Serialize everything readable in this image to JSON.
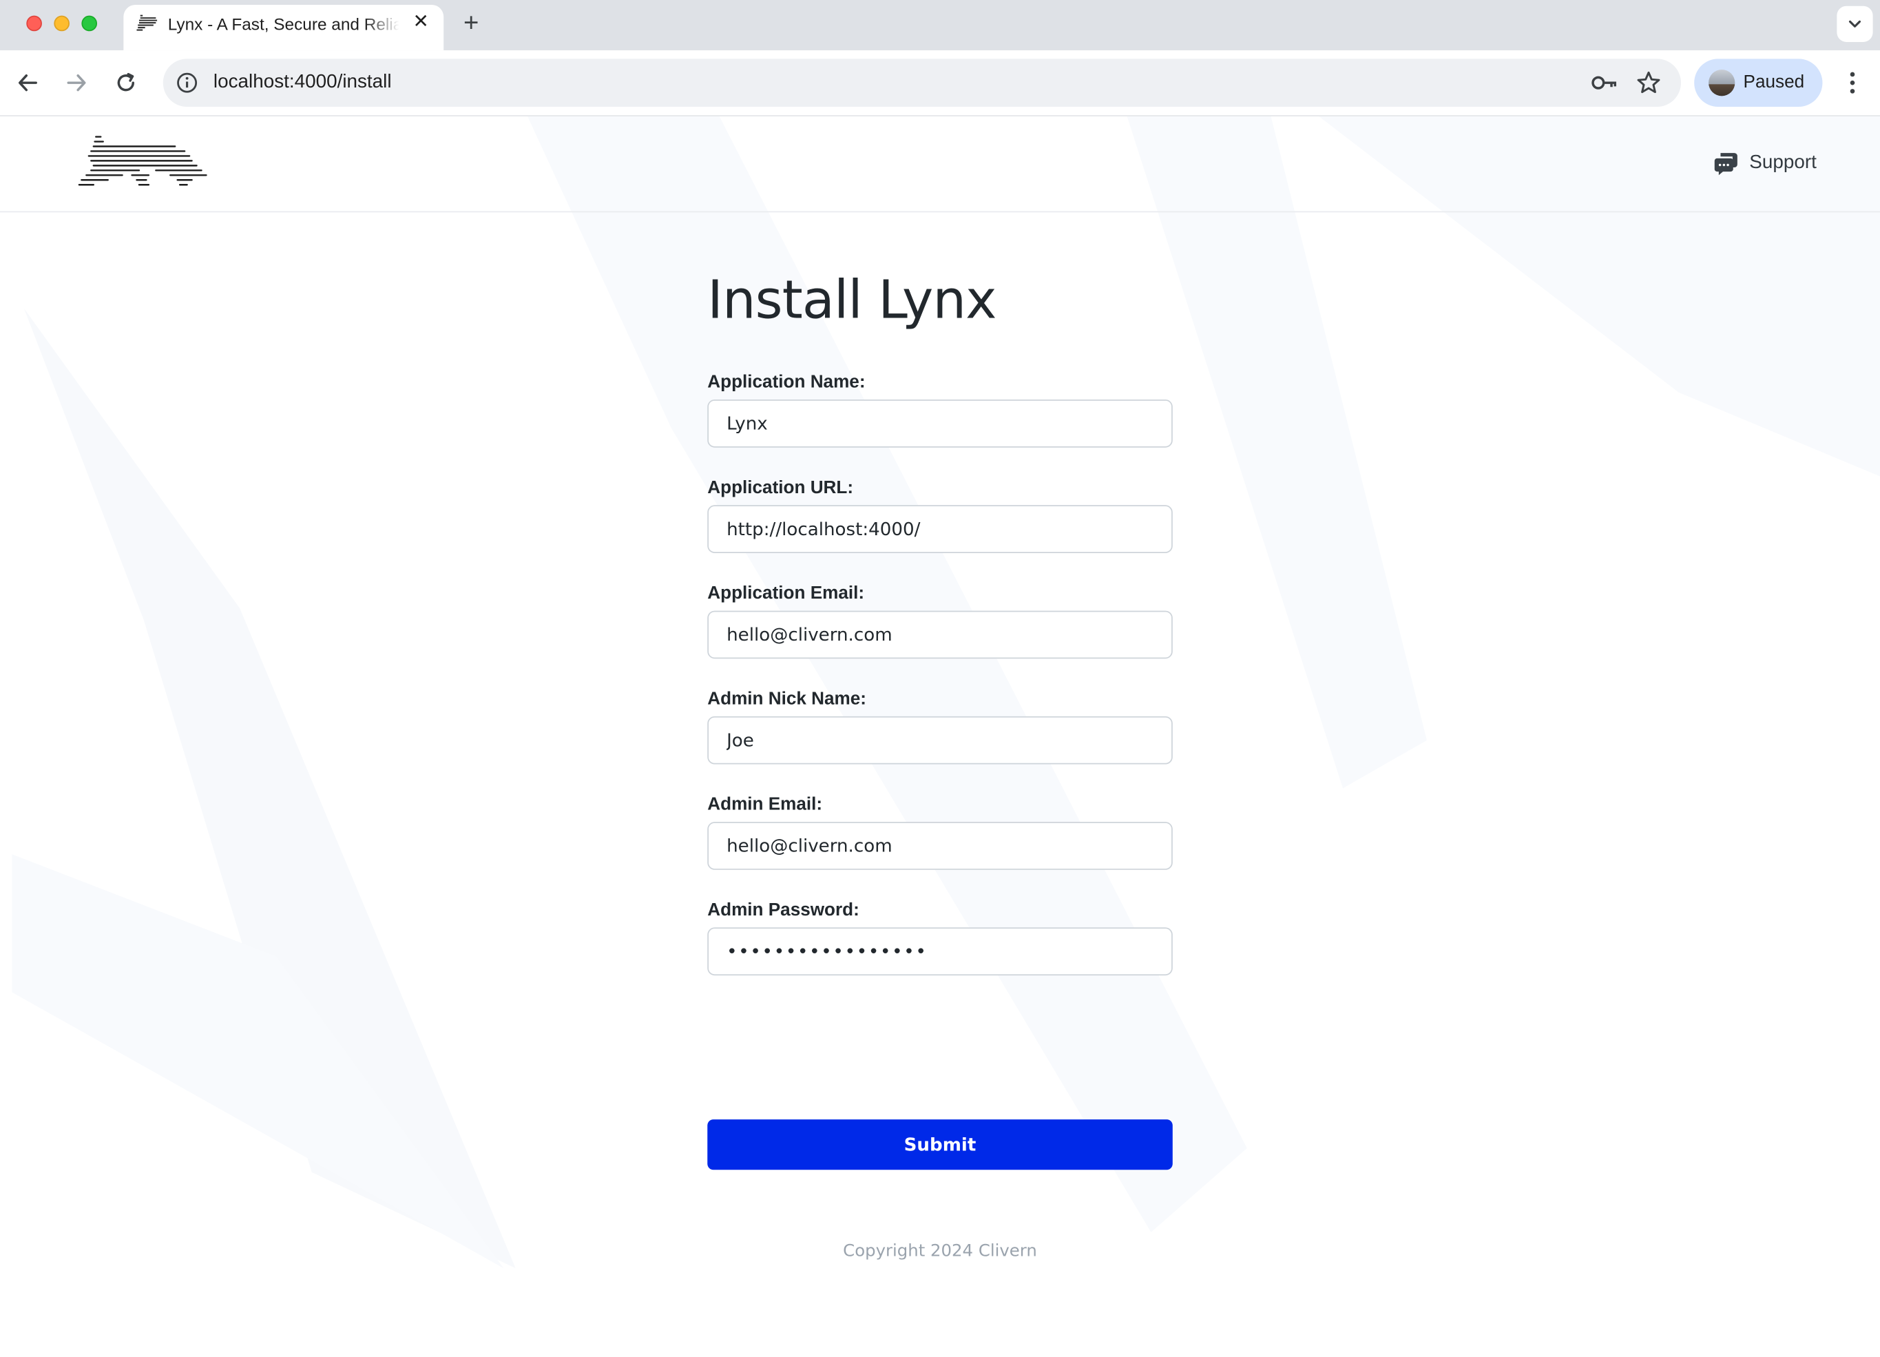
{
  "browser": {
    "tab_title": "Lynx - A Fast, Secure and Reliable",
    "tab_close": "✕",
    "new_tab": "+",
    "url": "localhost:4000/install",
    "profile_label": "Paused"
  },
  "header": {
    "support_label": "Support"
  },
  "form": {
    "title": "Install Lynx",
    "fields": [
      {
        "label": "Application Name:",
        "value": "Lynx"
      },
      {
        "label": "Application URL:",
        "value": "http://localhost:4000/"
      },
      {
        "label": "Application Email:",
        "value": "hello@clivern.com"
      },
      {
        "label": "Admin Nick Name:",
        "value": "Joe"
      },
      {
        "label": "Admin Email:",
        "value": "hello@clivern.com"
      },
      {
        "label": "Admin Password:",
        "value": "•••••••••••••••••"
      }
    ],
    "submit_label": "Submit"
  },
  "footer": {
    "copyright": "Copyright 2024 Clivern"
  },
  "colors": {
    "accent": "#0029e8",
    "text": "#22282d",
    "muted": "#9aa3ad"
  }
}
